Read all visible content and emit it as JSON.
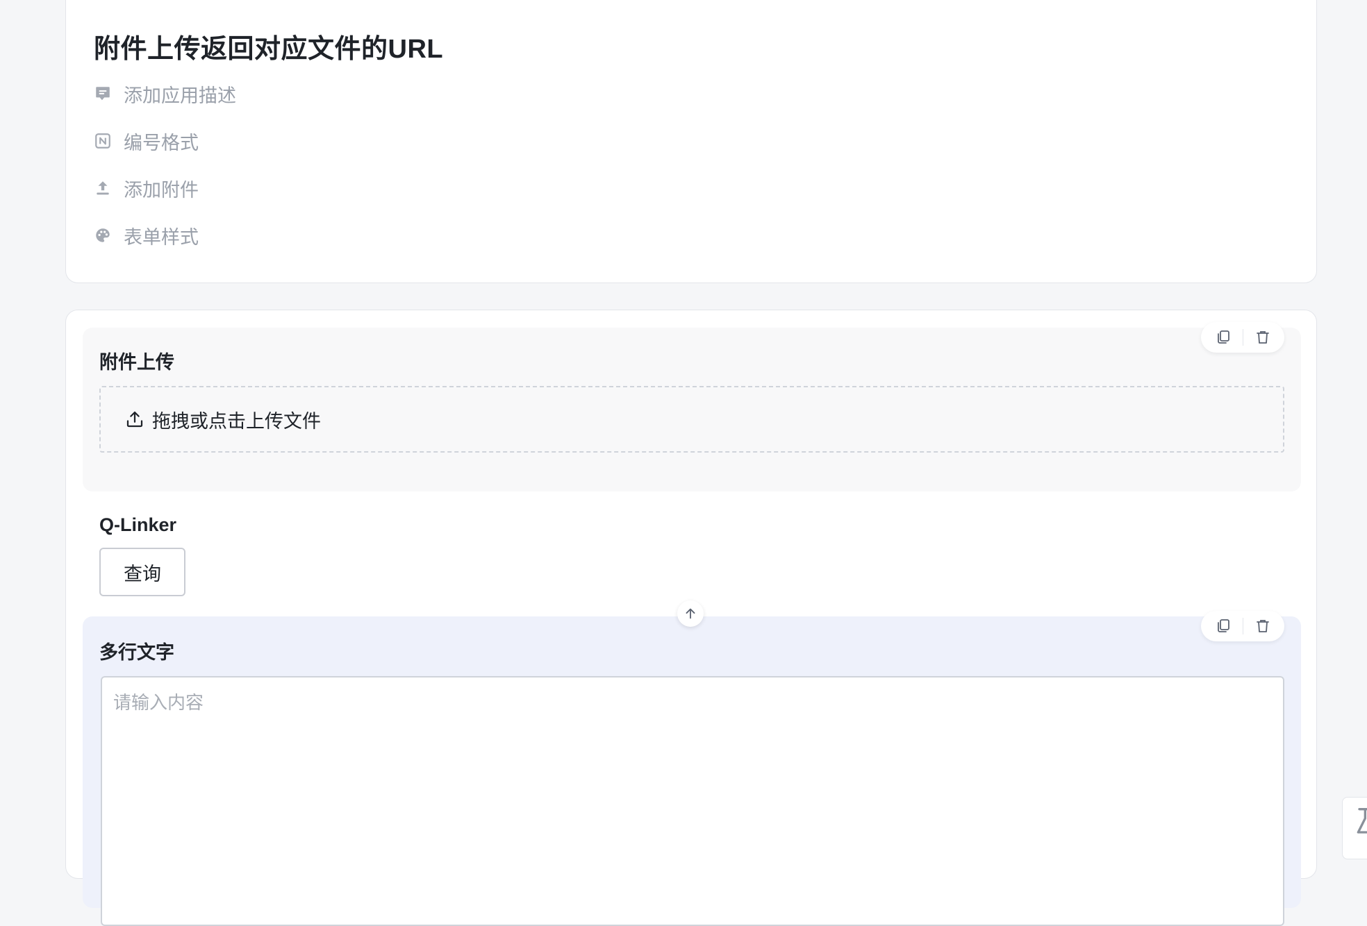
{
  "header": {
    "title": "附件上传返回对应文件的URL",
    "meta_items": [
      {
        "icon": "comment-icon",
        "label": "添加应用描述"
      },
      {
        "icon": "numbering-icon",
        "label": "编号格式"
      },
      {
        "icon": "upload-icon",
        "label": "添加附件"
      },
      {
        "icon": "palette-icon",
        "label": "表单样式"
      }
    ]
  },
  "form": {
    "upload_field": {
      "label": "附件上传",
      "dropzone_text": "拖拽或点击上传文件",
      "actions": [
        "copy-icon",
        "trash-icon"
      ]
    },
    "linker_field": {
      "label": "Q-Linker",
      "button_label": "查询"
    },
    "text_field": {
      "label": "多行文字",
      "placeholder": "请输入内容",
      "value": "",
      "actions": [
        "copy-icon",
        "trash-icon"
      ]
    },
    "move_up_icon": "arrow-up-icon"
  },
  "colors": {
    "page_bg": "#f5f6f8",
    "card_bg": "#ffffff",
    "selected_field_bg": "#eef1fb",
    "field_bg": "#f8f8f9",
    "muted_text": "#9aa0aa",
    "primary_text": "#1f2329"
  }
}
